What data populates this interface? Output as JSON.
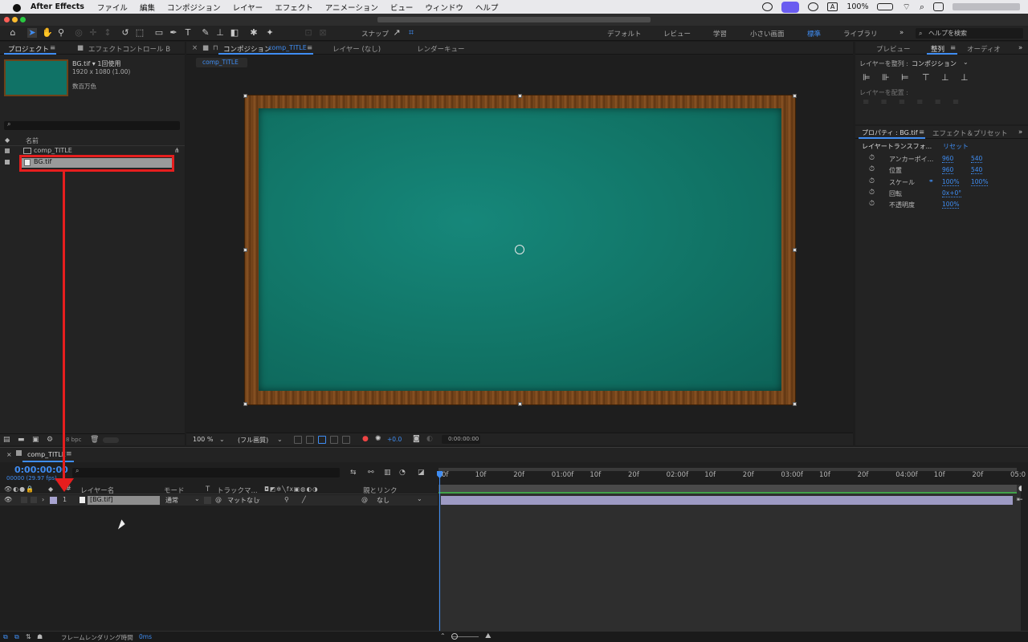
{
  "menubar": {
    "app_name": "After Effects",
    "items": [
      "ファイル",
      "編集",
      "コンポジション",
      "レイヤー",
      "エフェクト",
      "アニメーション",
      "ビュー",
      "ウィンドウ",
      "ヘルプ"
    ],
    "input_method": "A",
    "battery": "100%"
  },
  "toolbar": {
    "snap_label": "スナップ",
    "workspaces": [
      "デフォルト",
      "レビュー",
      "学習",
      "小さい画面",
      "標準",
      "ライブラリ"
    ],
    "active_workspace": "標準",
    "help_placeholder": "ヘルプを検索"
  },
  "project_panel": {
    "tabs": [
      "プロジェクト",
      "エフェクトコントロール B"
    ],
    "selected_name": "BG.tif ▾ 1回使用",
    "selected_dims": "1920 x 1080 (1.00)",
    "selected_color": "数百万色",
    "column_name": "名前",
    "items": [
      {
        "name": "comp_TITLE",
        "type": "composition"
      },
      {
        "name": "BG.tif",
        "type": "footage"
      }
    ],
    "bpc": "8 bpc"
  },
  "composition_panel": {
    "tabs": [
      "コンポジション comp_TITLE",
      "レイヤー (なし)",
      "レンダーキュー"
    ],
    "comp_label": "コンポジション",
    "comp_name": "comp_TITLE",
    "layer_tab": "レイヤー (なし)",
    "render_tab": "レンダーキュー",
    "breadcrumb": "comp_TITLE",
    "zoom": "100 %",
    "quality": "(フル画質)",
    "exposure": "+0.0",
    "timecode": "0:00:00:00",
    "colors": {
      "board": "#117466",
      "frame": "#7a4a1e"
    }
  },
  "right_panel": {
    "tabs": [
      "プレビュー",
      "整列",
      "オーディオ"
    ],
    "align_label": "レイヤーを整列 :",
    "align_target": "コンポジション",
    "distribute_label": "レイヤーを配置 :"
  },
  "properties_panel": {
    "tabs": [
      "プロパティ : BG.tif",
      "エフェクト＆プリセット"
    ],
    "section": "レイヤートランスフォ...",
    "reset": "リセット",
    "props": [
      {
        "name": "アンカーポイ...",
        "v1": "960",
        "v2": "540"
      },
      {
        "name": "位置",
        "v1": "960",
        "v2": "540"
      },
      {
        "name": "スケール",
        "v1": "100%",
        "v2": "100%"
      },
      {
        "name": "回転",
        "v1": "0x+0°",
        "v2": ""
      },
      {
        "name": "不透明度",
        "v1": "100%",
        "v2": ""
      }
    ]
  },
  "timeline": {
    "comp_tab": "comp_TITLE",
    "timecode": "0:00:00:00",
    "fps": "00000 (29.97 fps)",
    "col_layer_name": "レイヤー名",
    "col_mode": "モード",
    "col_t": "T",
    "col_track": "トラックマ...",
    "col_parent": "親とリンク",
    "layer": {
      "index": "1",
      "name": "[BG.tif]",
      "mode": "通常",
      "track": "マットなし",
      "parent": "なし"
    },
    "ruler": [
      "0f",
      "10f",
      "20f",
      "01:00f",
      "10f",
      "20f",
      "02:00f",
      "10f",
      "20f",
      "03:00f",
      "10f",
      "20f",
      "04:00f",
      "10f",
      "20f",
      "05:0"
    ],
    "render_time_label": "フレームレンダリング時間",
    "render_time": "0ms"
  },
  "annotation": {
    "color": "#e61e1e"
  }
}
